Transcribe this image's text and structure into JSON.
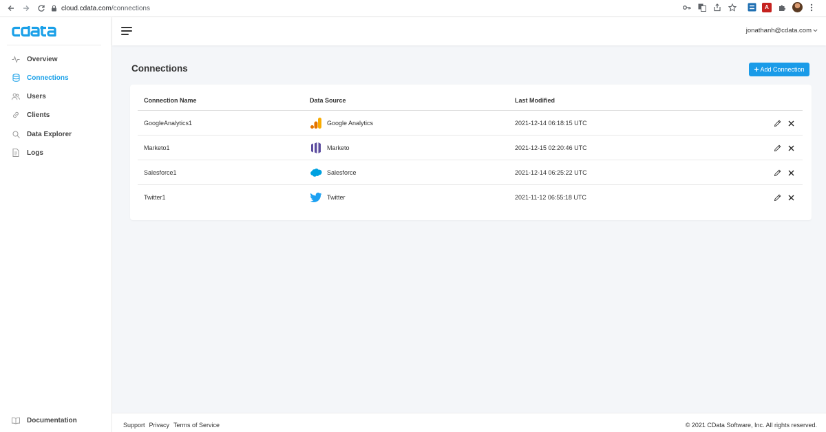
{
  "browser": {
    "url_domain": "cloud.cdata.com",
    "url_path": "/connections"
  },
  "app": {
    "logo_text": "cdata",
    "brand_color": "#1aa0e8"
  },
  "sidebar": {
    "items": [
      {
        "label": "Overview",
        "icon": "activity-icon",
        "active": false
      },
      {
        "label": "Connections",
        "icon": "database-icon",
        "active": true
      },
      {
        "label": "Users",
        "icon": "users-icon",
        "active": false
      },
      {
        "label": "Clients",
        "icon": "link-icon",
        "active": false
      },
      {
        "label": "Data Explorer",
        "icon": "search-icon",
        "active": false
      },
      {
        "label": "Logs",
        "icon": "document-icon",
        "active": false
      }
    ],
    "documentation_label": "Documentation"
  },
  "header": {
    "user_email": "jonathanh@cdata.com"
  },
  "main": {
    "title": "Connections",
    "add_button_label": "Add Connection",
    "table": {
      "columns": [
        "Connection Name",
        "Data Source",
        "Last Modified"
      ],
      "rows": [
        {
          "name": "GoogleAnalytics1",
          "source": "Google Analytics",
          "source_icon": "google-analytics-icon",
          "modified": "2021-12-14 06:18:15 UTC"
        },
        {
          "name": "Marketo1",
          "source": "Marketo",
          "source_icon": "marketo-icon",
          "modified": "2021-12-15 02:20:46 UTC"
        },
        {
          "name": "Salesforce1",
          "source": "Salesforce",
          "source_icon": "salesforce-icon",
          "modified": "2021-12-14 06:25:22 UTC"
        },
        {
          "name": "Twitter1",
          "source": "Twitter",
          "source_icon": "twitter-icon",
          "modified": "2021-11-12 06:55:18 UTC"
        }
      ]
    }
  },
  "footer": {
    "links": [
      "Support",
      "Privacy",
      "Terms of Service"
    ],
    "copyright": "© 2021 CData Software, Inc. All rights reserved."
  }
}
